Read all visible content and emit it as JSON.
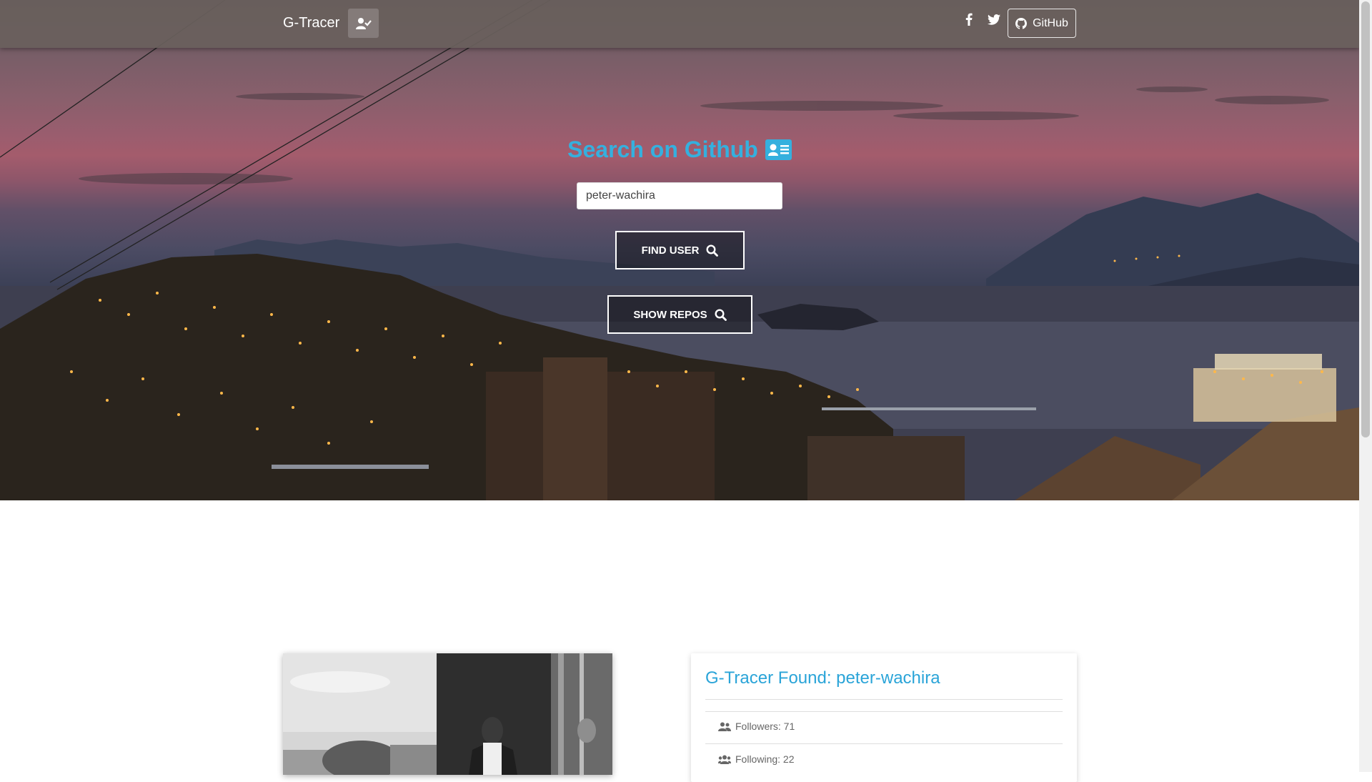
{
  "navbar": {
    "brand": "G-Tracer",
    "github_label": "GitHub"
  },
  "search": {
    "title": "Search on Github",
    "input_value": "peter-wachira",
    "find_user_label": "FIND USER",
    "show_repos_label": "SHOW REPOS"
  },
  "result": {
    "title": "G-Tracer Found: peter-wachira",
    "followers_label": "Followers: 71",
    "following_label": "Following: 22"
  },
  "colors": {
    "accent": "#35b0de",
    "card_title": "#2aa4d8"
  },
  "icons": [
    "user-check-icon",
    "facebook-icon",
    "twitter-icon",
    "github-icon",
    "id-card-icon",
    "search-icon",
    "users-icon"
  ]
}
